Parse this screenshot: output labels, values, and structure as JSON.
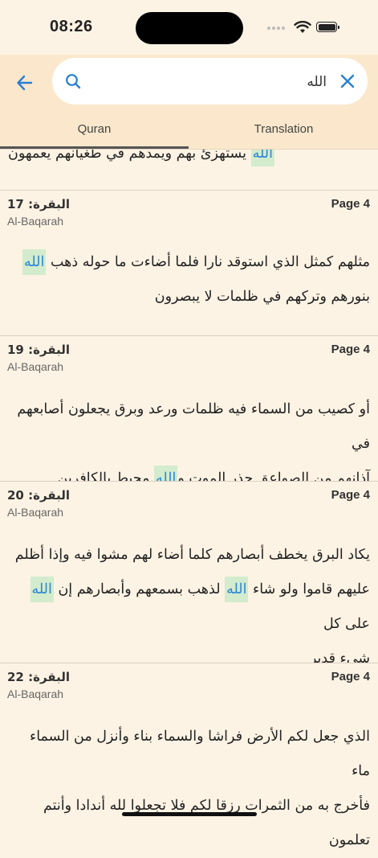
{
  "status": {
    "time": "08:26"
  },
  "search": {
    "query": "الله"
  },
  "tabs": [
    {
      "label": "Quran"
    },
    {
      "label": "Translation"
    }
  ],
  "partial_verse": {
    "text_parts": [
      "",
      "الله",
      " يستهزئ بهم ويمدهم في طغيانهم يعمهون"
    ]
  },
  "verses": [
    {
      "surah_ar": "البقرة:",
      "number": "17",
      "surah_en": "Al-Baqarah",
      "page": "Page 4",
      "line1": [
        "مثلهم كمثل الذي استوقد نارا فلما أضاءت ما حوله ذهب ",
        "الله"
      ],
      "line2": "بنورهم وتركهم في ظلمات لا يبصرون"
    },
    {
      "surah_ar": "البقرة:",
      "number": "19",
      "surah_en": "Al-Baqarah",
      "page": "Page 4",
      "line1": "أو كصيب من السماء فيه ظلمات ورعد وبرق يجعلون أصابعهم في",
      "line2": [
        "آذانهم من الصواعق حذر الموت و",
        "الله",
        " محيط بالكافرين"
      ]
    },
    {
      "surah_ar": "البقرة:",
      "number": "20",
      "surah_en": "Al-Baqarah",
      "page": "Page 4",
      "line1": "يكاد البرق يخطف أبصارهم كلما أضاء لهم مشوا فيه وإذا أظلم",
      "line2": [
        "عليهم قاموا ولو شاء ",
        "الله",
        " لذهب بسمعهم وأبصارهم إن ",
        "الله",
        " على كل"
      ],
      "line3": "شيء قدير"
    },
    {
      "surah_ar": "البقرة:",
      "number": "22",
      "surah_en": "Al-Baqarah",
      "page": "Page 4",
      "line1": "الذي جعل لكم الأرض فراشا والسماء بناء وأنزل من السماء ماء",
      "line2": "فأخرج به من الثمرات رزقا لكم فلا تجعلوا لله أندادا وأنتم تعلمون"
    }
  ]
}
